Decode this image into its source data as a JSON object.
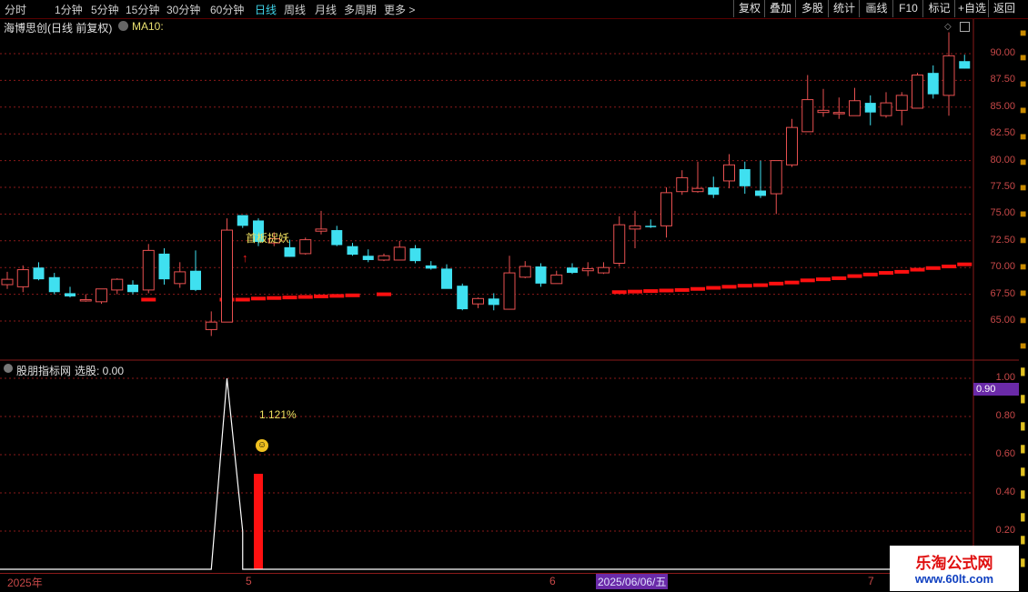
{
  "toolbar": {
    "periods": [
      "分时",
      "1分钟",
      "5分钟",
      "15分钟",
      "30分钟",
      "60分钟",
      "日线",
      "周线",
      "月线",
      "多周期",
      "更多"
    ],
    "active_period": "日线",
    "buttons": [
      "复权",
      "叠加",
      "多股",
      "统计",
      "画线",
      "F10",
      "标记",
      "+自选",
      "返回"
    ]
  },
  "main_chart": {
    "title": "海博思创(日线 前复权)",
    "ma_label": "MA10:",
    "annotation_text": "首板捉妖",
    "y_ticks": [
      "90.00",
      "87.50",
      "85.00",
      "82.50",
      "80.00",
      "77.50",
      "75.00",
      "72.50",
      "70.00",
      "67.50",
      "65.00"
    ]
  },
  "sub_chart": {
    "title": "股朋指标网",
    "select_label": "选股: 0.00",
    "value_label": "1.121%",
    "y_ticks": [
      "1.00",
      "0.80",
      "0.60",
      "0.40",
      "0.20"
    ],
    "current_value": "0.90"
  },
  "time_axis": {
    "labels": [
      "2025年",
      "5",
      "6",
      "7"
    ],
    "cursor_date": "2025/06/06/五"
  },
  "watermark": {
    "line1": "乐淘公式网",
    "line2": "www.60lt.com"
  },
  "colors": {
    "up": "#e85050",
    "down": "#3fe0f0",
    "ma": "#ff1010",
    "grid": "#8a1a1a",
    "accent_cyan": "#3fd3e8",
    "highlight_purple": "#6a2aa8"
  },
  "chart_data": {
    "type": "candlestick",
    "title": "海博思创(日线 前复权)",
    "ylim": [
      63.5,
      92.5
    ],
    "candles": [
      {
        "o": 68.4,
        "h": 69.6,
        "l": 68.0,
        "c": 68.9
      },
      {
        "o": 68.2,
        "h": 70.2,
        "l": 67.7,
        "c": 69.8
      },
      {
        "o": 70.0,
        "h": 70.5,
        "l": 68.8,
        "c": 68.9
      },
      {
        "o": 69.1,
        "h": 69.5,
        "l": 67.5,
        "c": 67.7
      },
      {
        "o": 67.6,
        "h": 68.2,
        "l": 67.2,
        "c": 67.3
      },
      {
        "o": 67.0,
        "h": 67.5,
        "l": 66.8,
        "c": 67.0
      },
      {
        "o": 66.8,
        "h": 68.0,
        "l": 66.6,
        "c": 68.0
      },
      {
        "o": 67.9,
        "h": 69.0,
        "l": 67.5,
        "c": 68.9
      },
      {
        "o": 68.4,
        "h": 68.8,
        "l": 67.5,
        "c": 67.7
      },
      {
        "o": 67.9,
        "h": 72.2,
        "l": 67.6,
        "c": 71.6
      },
      {
        "o": 71.3,
        "h": 71.8,
        "l": 68.4,
        "c": 68.9
      },
      {
        "o": 68.5,
        "h": 70.5,
        "l": 68.1,
        "c": 69.6
      },
      {
        "o": 69.7,
        "h": 71.6,
        "l": 67.8,
        "c": 67.9
      },
      {
        "o": 64.2,
        "h": 65.9,
        "l": 63.6,
        "c": 64.9
      },
      {
        "o": 64.9,
        "h": 74.6,
        "l": 64.9,
        "c": 73.5
      },
      {
        "o": 74.9,
        "h": 74.9,
        "l": 73.7,
        "c": 73.9
      },
      {
        "o": 74.4,
        "h": 74.6,
        "l": 72.0,
        "c": 72.4
      },
      {
        "o": 72.3,
        "h": 73.3,
        "l": 72.0,
        "c": 72.7
      },
      {
        "o": 71.9,
        "h": 72.6,
        "l": 71.0,
        "c": 71.0
      },
      {
        "o": 71.3,
        "h": 72.8,
        "l": 71.2,
        "c": 72.6
      },
      {
        "o": 73.4,
        "h": 75.3,
        "l": 73.1,
        "c": 73.6
      },
      {
        "o": 73.5,
        "h": 73.9,
        "l": 72.0,
        "c": 72.1
      },
      {
        "o": 72.0,
        "h": 72.3,
        "l": 71.1,
        "c": 71.2
      },
      {
        "o": 71.1,
        "h": 71.7,
        "l": 70.5,
        "c": 70.7
      },
      {
        "o": 70.7,
        "h": 71.3,
        "l": 70.6,
        "c": 71.1
      },
      {
        "o": 70.7,
        "h": 72.5,
        "l": 70.7,
        "c": 71.9
      },
      {
        "o": 71.8,
        "h": 72.1,
        "l": 70.4,
        "c": 70.6
      },
      {
        "o": 70.2,
        "h": 70.6,
        "l": 69.8,
        "c": 69.9
      },
      {
        "o": 69.9,
        "h": 70.3,
        "l": 68.4,
        "c": 68.0
      },
      {
        "o": 68.3,
        "h": 68.5,
        "l": 66.0,
        "c": 66.1
      },
      {
        "o": 66.6,
        "h": 67.2,
        "l": 66.2,
        "c": 67.1
      },
      {
        "o": 67.1,
        "h": 67.6,
        "l": 66.0,
        "c": 66.5
      },
      {
        "o": 66.1,
        "h": 71.1,
        "l": 66.1,
        "c": 69.5
      },
      {
        "o": 69.1,
        "h": 70.6,
        "l": 69.0,
        "c": 70.1
      },
      {
        "o": 70.1,
        "h": 70.4,
        "l": 68.2,
        "c": 68.5
      },
      {
        "o": 68.5,
        "h": 69.7,
        "l": 68.5,
        "c": 69.3
      },
      {
        "o": 70.0,
        "h": 70.4,
        "l": 69.4,
        "c": 69.5
      },
      {
        "o": 69.7,
        "h": 70.5,
        "l": 69.2,
        "c": 69.9
      },
      {
        "o": 69.5,
        "h": 70.5,
        "l": 69.4,
        "c": 70.0
      },
      {
        "o": 70.4,
        "h": 74.8,
        "l": 70.1,
        "c": 74.0
      },
      {
        "o": 73.6,
        "h": 75.3,
        "l": 71.8,
        "c": 73.9
      },
      {
        "o": 73.9,
        "h": 74.5,
        "l": 73.7,
        "c": 73.8
      },
      {
        "o": 73.9,
        "h": 77.5,
        "l": 72.8,
        "c": 77.0
      },
      {
        "o": 77.1,
        "h": 79.1,
        "l": 76.8,
        "c": 78.4
      },
      {
        "o": 77.1,
        "h": 79.9,
        "l": 77.0,
        "c": 77.4
      },
      {
        "o": 77.5,
        "h": 78.5,
        "l": 76.5,
        "c": 76.8
      },
      {
        "o": 78.1,
        "h": 80.6,
        "l": 77.4,
        "c": 79.6
      },
      {
        "o": 79.2,
        "h": 79.9,
        "l": 76.9,
        "c": 77.6
      },
      {
        "o": 77.2,
        "h": 80.0,
        "l": 76.5,
        "c": 76.7
      },
      {
        "o": 76.9,
        "h": 79.9,
        "l": 75.0,
        "c": 80.0
      },
      {
        "o": 79.6,
        "h": 83.9,
        "l": 79.4,
        "c": 83.1
      },
      {
        "o": 82.7,
        "h": 88.0,
        "l": 82.7,
        "c": 85.7
      },
      {
        "o": 84.5,
        "h": 86.7,
        "l": 84.1,
        "c": 84.7
      },
      {
        "o": 84.5,
        "h": 85.9,
        "l": 83.9,
        "c": 84.5
      },
      {
        "o": 84.2,
        "h": 86.8,
        "l": 84.2,
        "c": 85.6
      },
      {
        "o": 85.4,
        "h": 86.1,
        "l": 83.3,
        "c": 84.5
      },
      {
        "o": 84.2,
        "h": 86.4,
        "l": 84.0,
        "c": 85.4
      },
      {
        "o": 84.7,
        "h": 86.4,
        "l": 83.3,
        "c": 86.1
      },
      {
        "o": 84.9,
        "h": 88.2,
        "l": 84.9,
        "c": 88.0
      },
      {
        "o": 88.2,
        "h": 88.9,
        "l": 85.8,
        "c": 86.2
      },
      {
        "o": 86.1,
        "h": 92.0,
        "l": 84.2,
        "c": 89.8
      },
      {
        "o": 89.3,
        "h": 89.9,
        "l": 88.6,
        "c": 88.6
      }
    ],
    "ma_segments": [
      {
        "from": 9,
        "to": 9,
        "values": [
          67.0
        ]
      },
      {
        "from": 14,
        "to": 22,
        "values": [
          67.0,
          67.0,
          67.1,
          67.15,
          67.2,
          67.25,
          67.3,
          67.35,
          67.4
        ]
      },
      {
        "from": 24,
        "to": 24,
        "values": [
          67.5
        ]
      },
      {
        "from": 39,
        "to": 61,
        "values": [
          67.7,
          67.75,
          67.8,
          67.85,
          67.9,
          68.0,
          68.1,
          68.2,
          68.3,
          68.35,
          68.5,
          68.6,
          68.8,
          68.9,
          69.0,
          69.2,
          69.35,
          69.5,
          69.6,
          69.8,
          69.95,
          70.1,
          70.3
        ]
      }
    ],
    "signal_index": 15,
    "sub": {
      "line_y": [
        0,
        0,
        0,
        0,
        0,
        0,
        0,
        0,
        0,
        0,
        0,
        0,
        0,
        0,
        1.0,
        0.2,
        0,
        0,
        0,
        0
      ],
      "bar_index": 16,
      "bar_value": 0.5,
      "ylim": [
        0,
        1.05
      ]
    }
  }
}
